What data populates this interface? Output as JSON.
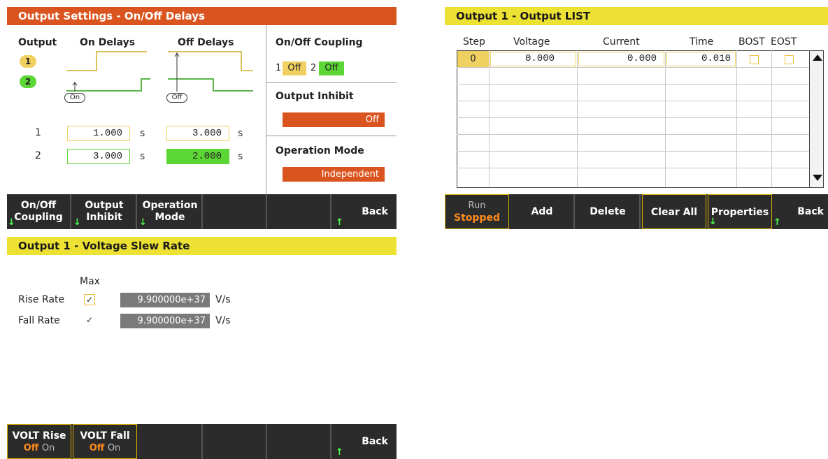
{
  "delays": {
    "title": "Output Settings - On/Off Delays",
    "col_output": "Output",
    "col_on": "On Delays",
    "col_off": "Off Delays",
    "badge1": "1",
    "badge2": "2",
    "on_marker": "On",
    "off_marker": "Off",
    "rows": [
      {
        "label": "1",
        "on": "1.000",
        "off": "3.000",
        "unit": "s"
      },
      {
        "label": "2",
        "on": "3.000",
        "off": "2.000",
        "unit": "s"
      }
    ],
    "coupling_title": "On/Off Coupling",
    "coupling_1": "1",
    "coupling_1_val": "Off",
    "coupling_2": "2",
    "coupling_2_val": "Off",
    "inhibit_title": "Output Inhibit",
    "inhibit_val": "Off",
    "mode_title": "Operation Mode",
    "mode_val": "Independent",
    "softkeys": {
      "coupling": [
        "On/Off",
        "Coupling"
      ],
      "inhibit": [
        "Output",
        "Inhibit"
      ],
      "mode": [
        "Operation",
        "Mode"
      ],
      "back": "Back"
    }
  },
  "list": {
    "title": "Output 1 - Output LIST",
    "headers": [
      "Step",
      "Voltage",
      "Current",
      "Time",
      "BOST",
      "EOST"
    ],
    "row0": {
      "step": "0",
      "voltage": "0.000",
      "current": "0.000",
      "time": "0.010"
    },
    "softkeys": {
      "run": "Run",
      "run_state": "Stopped",
      "add": "Add",
      "delete": "Delete",
      "clear": "Clear All",
      "properties": "Properties",
      "back": "Back"
    }
  },
  "slew": {
    "title": "Output 1 - Voltage Slew Rate",
    "max_label": "Max",
    "rise_label": "Rise Rate",
    "fall_label": "Fall Rate",
    "rise_value": "9.900000e+37",
    "fall_value": "9.900000e+37",
    "unit": "V/s",
    "check": "✓",
    "softkeys": {
      "rise": "VOLT Rise",
      "fall": "VOLT Fall",
      "off": "Off",
      "on": "On",
      "back": "Back"
    }
  },
  "colors": {
    "orange_header": "#d9541e",
    "yellow_header": "#ede233",
    "yellow": "#f0d060",
    "green": "#5cd635",
    "orange_value": "#d9541e"
  }
}
